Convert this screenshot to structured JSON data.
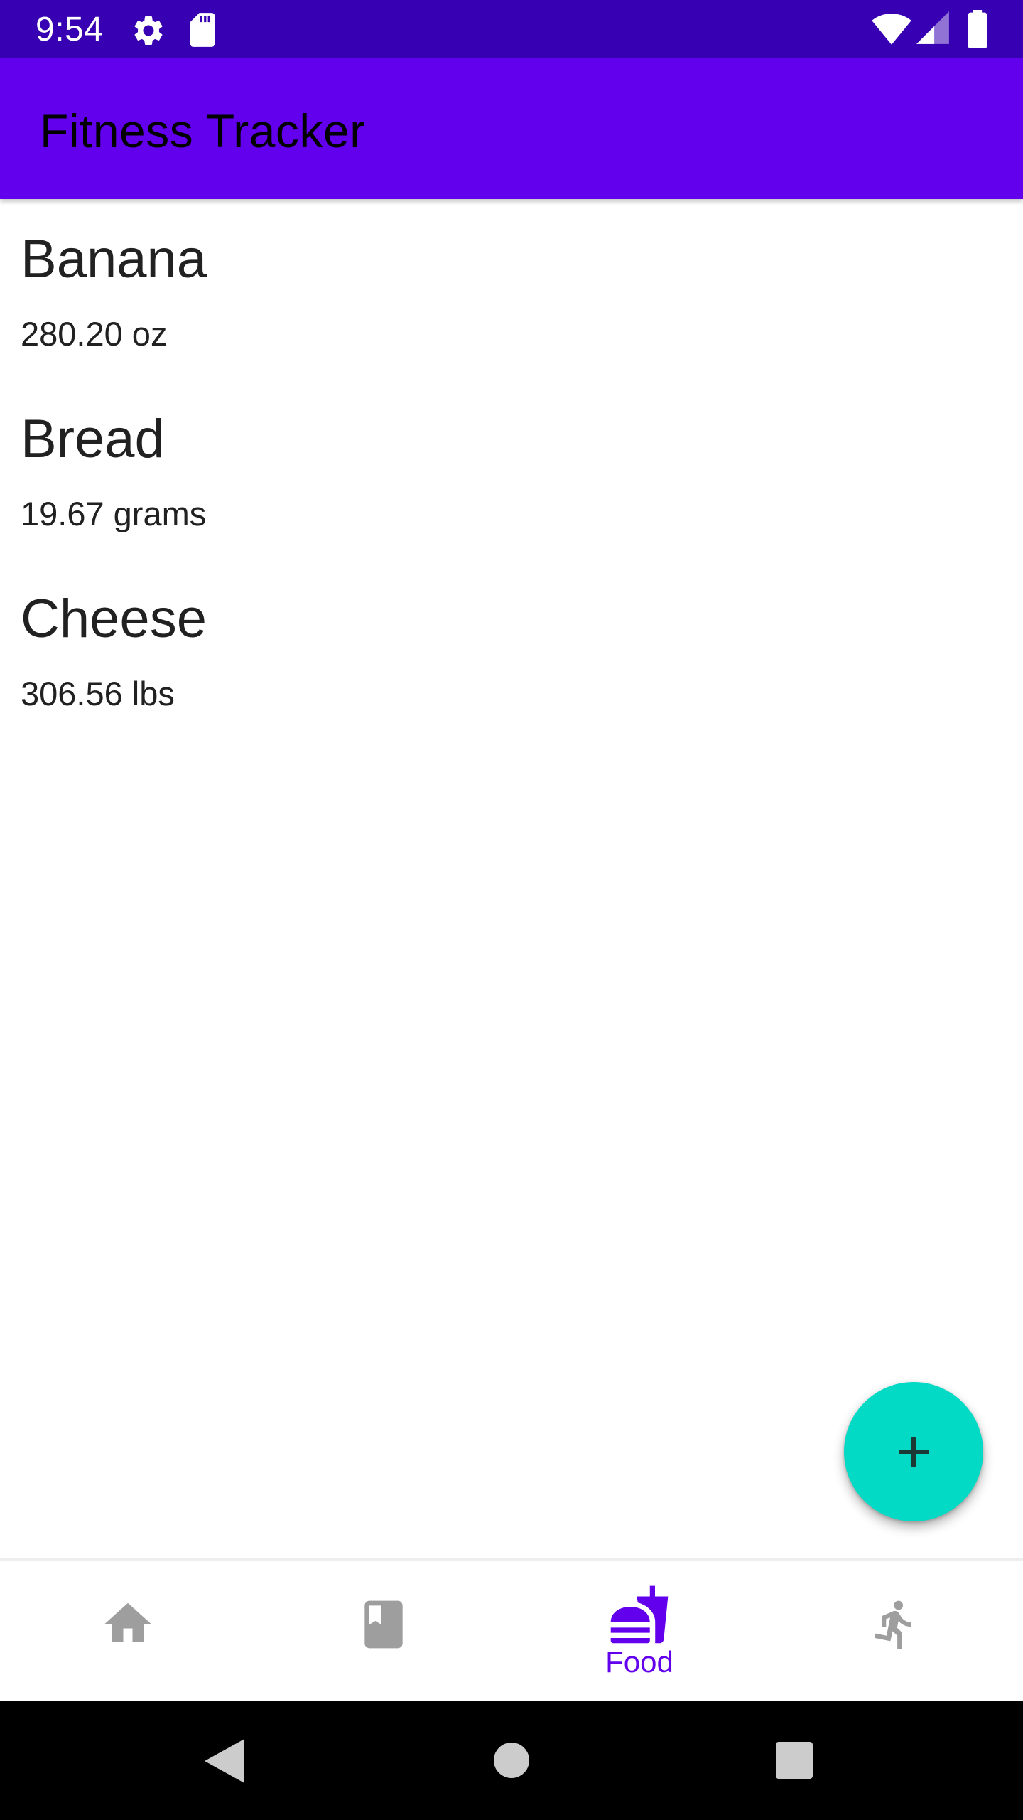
{
  "status_bar": {
    "time": "9:54",
    "icons": [
      "gear-icon",
      "sd-card-icon",
      "wifi-icon",
      "cellular-signal-icon",
      "battery-icon"
    ]
  },
  "app_bar": {
    "title": "Fitness Tracker"
  },
  "food_list": {
    "items": [
      {
        "name": "Banana",
        "amount": "280.20 oz"
      },
      {
        "name": "Bread",
        "amount": "19.67 grams"
      },
      {
        "name": "Cheese",
        "amount": "306.56 lbs"
      }
    ]
  },
  "fab": {
    "icon": "plus-icon"
  },
  "bottom_nav": {
    "items": [
      {
        "icon": "home-icon",
        "label": "",
        "selected": false
      },
      {
        "icon": "book-icon",
        "label": "",
        "selected": false
      },
      {
        "icon": "fastfood-icon",
        "label": "Food",
        "selected": true
      },
      {
        "icon": "running-icon",
        "label": "",
        "selected": false
      }
    ]
  },
  "system_nav": {
    "icons": [
      "back-icon",
      "home-circle-icon",
      "recents-icon"
    ]
  },
  "colors": {
    "status_bar": "#3700b3",
    "app_bar": "#6200ee",
    "fab": "#03dac5",
    "nav_selected": "#6200ee",
    "nav_unselected": "#9e9e9e",
    "text_primary": "#212121"
  }
}
